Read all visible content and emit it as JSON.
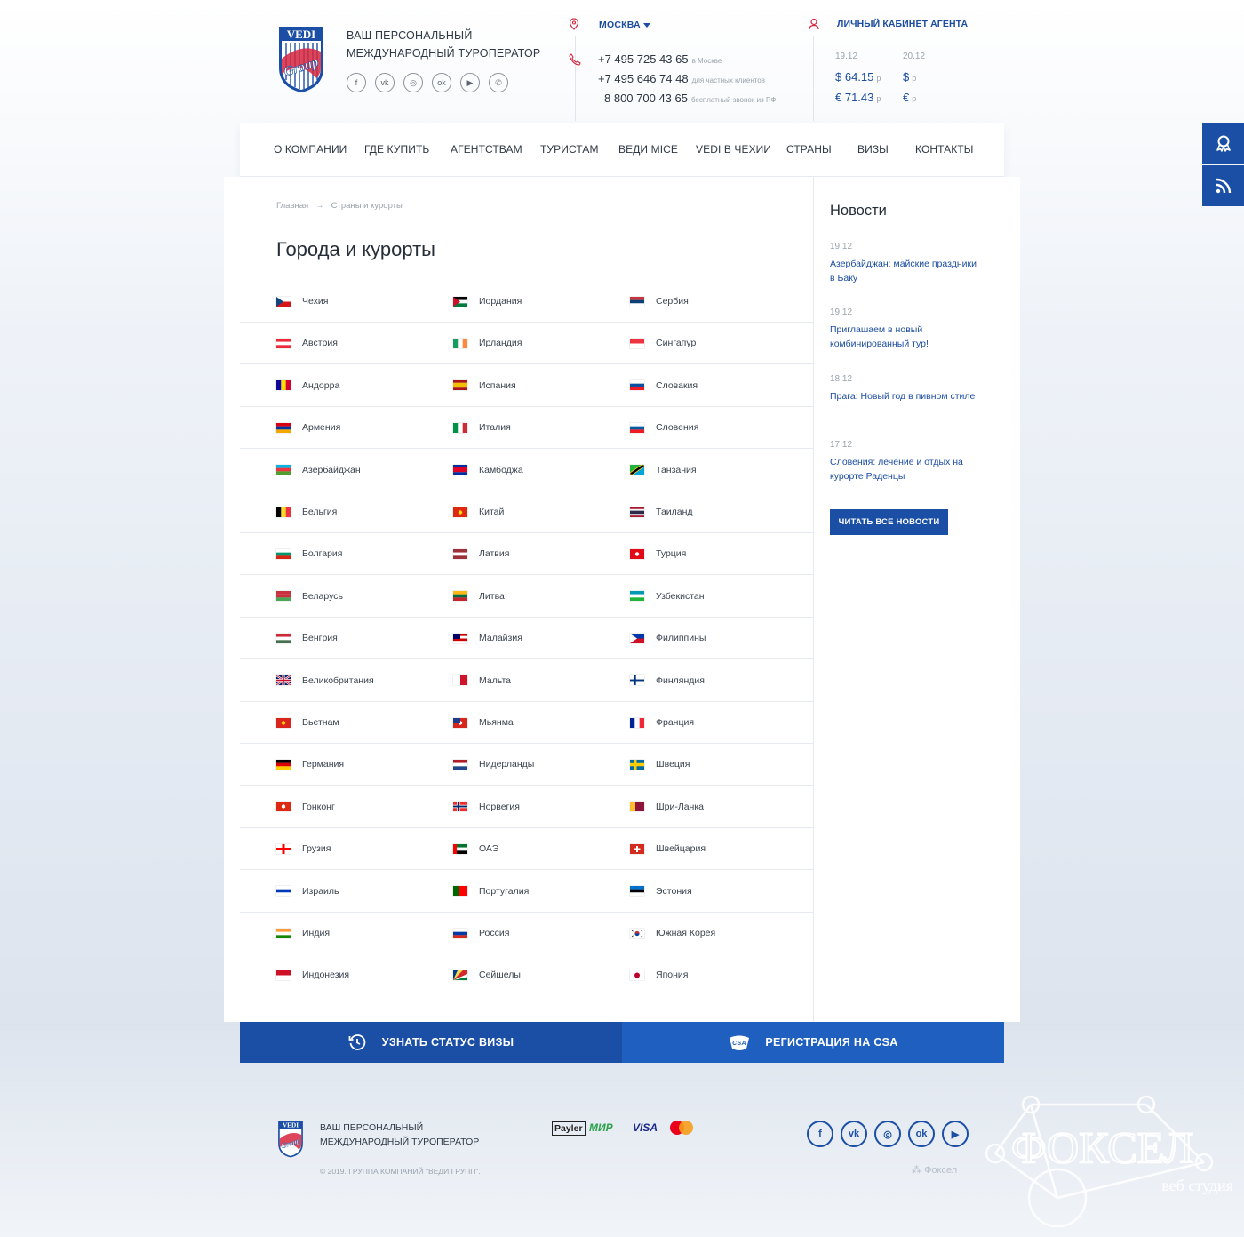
{
  "header": {
    "logo_text": "VEDI Group",
    "tagline": [
      "ВАШ ПЕРСОНАЛЬНЫЙ",
      "МЕЖДУНАРОДНЫЙ ТУРОПЕРАТОР"
    ],
    "socials": [
      "facebook-icon",
      "vk-icon",
      "instagram-icon",
      "odnoklassniki-icon",
      "youtube-icon",
      "whatsapp-icon"
    ],
    "city": "МОСКВА",
    "phones": [
      {
        "number": "+7 495 725 43 65",
        "note": "в Москве"
      },
      {
        "number": "+7 495 646 74 48",
        "note": "для частных клиентов"
      },
      {
        "number": "8 800 700 43 65",
        "note": "бесплатный звонок из РФ"
      }
    ],
    "agent_link": "ЛИЧНЫЙ КАБИНЕТ АГЕНТА",
    "rates": {
      "date1": "19.12",
      "date2": "20.12",
      "usd1": "$ 64.15",
      "eur1": "€ 71.43",
      "usd2": "$",
      "eur2": "€",
      "unit": "р"
    }
  },
  "nav": [
    "О КОМПАНИИ",
    "ГДЕ КУПИТЬ",
    "АГЕНТСТВАМ",
    "ТУРИСТАМ",
    "ВЕДИ MICE",
    "VEDI В ЧЕХИИ",
    "СТРАНЫ",
    "ВИЗЫ",
    "КОНТАКТЫ"
  ],
  "breadcrumb": {
    "home": "Главная",
    "arrow": "→",
    "current": "Страны и курорты"
  },
  "page_title": "Города и курорты",
  "countries": {
    "col1": [
      "Чехия",
      "Австрия",
      "Андорра",
      "Армения",
      "Азербайджан",
      "Бельгия",
      "Болгария",
      "Беларусь",
      "Венгрия",
      "Великобритания",
      "Вьетнам",
      "Германия",
      "Гонконг",
      "Грузия",
      "Израиль",
      "Индия",
      "Индонезия"
    ],
    "col2": [
      "Иордания",
      "Ирландия",
      "Испания",
      "Италия",
      "Камбоджа",
      "Китай",
      "Латвия",
      "Литва",
      "Малайзия",
      "Мальта",
      "Мьянма",
      "Нидерланды",
      "Норвегия",
      "ОАЭ",
      "Португалия",
      "Россия",
      "Сейшелы"
    ],
    "col3": [
      "Сербия",
      "Сингапур",
      "Словакия",
      "Словения",
      "Танзания",
      "Таиланд",
      "Турция",
      "Узбекистан",
      "Филиппины",
      "Финляндия",
      "Франция",
      "Швеция",
      "Шри-Ланка",
      "Швейцария",
      "Эстония",
      "Южная Корея",
      "Япония"
    ]
  },
  "news": {
    "heading": "Новости",
    "items": [
      {
        "date": "19.12",
        "title": "Азербайджан: майские праздники в Баку"
      },
      {
        "date": "19.12",
        "title": "Приглашаем в новый комбинированный тур!"
      },
      {
        "date": "18.12",
        "title": "Прага: Новый год в пивном стиле"
      },
      {
        "date": "17.12",
        "title": "Словения: лечение и отдых на курорте Раденцы"
      }
    ],
    "button": "ЧИТАТЬ ВСЕ НОВОСТИ"
  },
  "bottom_bar": {
    "visa_status": "УЗНАТЬ СТАТУС ВИЗЫ",
    "csa": "РЕГИСТРАЦИЯ НА CSA"
  },
  "footer": {
    "tagline": [
      "ВАШ ПЕРСОНАЛЬНЫЙ",
      "МЕЖДУНАРОДНЫЙ ТУРОПЕРАТОР"
    ],
    "copyright": "© 2019. ГРУППА КОМПАНИЙ \"ВЕДИ ГРУПП\".",
    "payments": [
      "Payler",
      "МИР",
      "VISA",
      "mastercard"
    ],
    "socials": [
      "facebook-icon",
      "vk-icon",
      "instagram-icon",
      "odnoklassniki-icon",
      "youtube-icon"
    ],
    "dev_credit": "Фоксел",
    "watermark": "ФОКСЕЛ",
    "watermark_sub": "веб студия"
  },
  "colors": {
    "accent": "#1b4fa6",
    "accent2": "#1f5fbf",
    "text": "#2b3440",
    "muted": "#9aa3ad"
  }
}
